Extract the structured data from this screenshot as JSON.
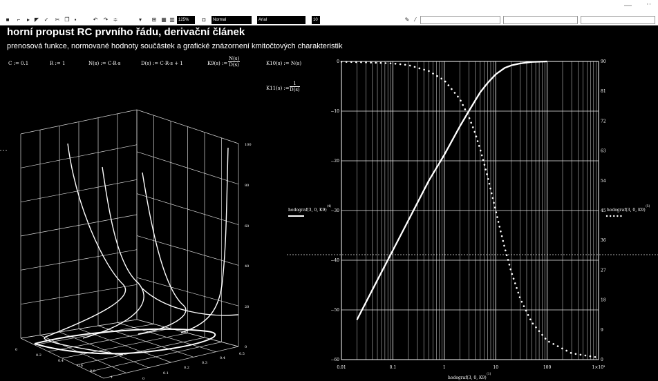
{
  "toolbar": {
    "zoom": "125%",
    "style": "Normal",
    "font": "Arial",
    "font_size": "10"
  },
  "document": {
    "title": "horní propust RC prvního řádu, derivační článek",
    "subtitle": "prenosová funkce, normované hodnoty součástek a grafické znázornení kmitočtových charakteristik",
    "definitions": [
      "C := 0.1",
      "R := 1",
      "N(s) := C·R·s",
      "D(s) := C·R·s + 1",
      "K10(s) := N(s)"
    ],
    "k9": {
      "lhs": "K9(s) :=",
      "num": "N(s)",
      "den": "D(s)"
    },
    "k11": {
      "lhs": "K11(s) :=",
      "num": "1",
      "den": "D(s)"
    }
  },
  "plot3d": {
    "z_ticks": [
      "100",
      "80",
      "60",
      "40",
      "20",
      "0"
    ],
    "x_ticks": [
      "0",
      "0.1",
      "0.2",
      "0.3",
      "0.4",
      "0.5"
    ],
    "y_ticks": [
      "0",
      "0.2",
      "0.4",
      "0.6",
      "0.8",
      "1"
    ]
  },
  "chart_data": {
    "type": "line",
    "x_scale": "log",
    "xlim": [
      0.01,
      1000
    ],
    "x_ticks": [
      "0.01",
      "0.1",
      "1",
      "10",
      "100",
      "1×10³"
    ],
    "ylim_left": [
      -60,
      0
    ],
    "y_ticks_left": [
      "0",
      "−10",
      "−20",
      "−30",
      "−40",
      "−50",
      "−60"
    ],
    "ylim_right": [
      0,
      90
    ],
    "y_ticks_right": [
      "90",
      "81",
      "72",
      "63",
      "54",
      "45",
      "36",
      "27",
      "18",
      "9",
      "0"
    ],
    "xlabel": "hodograf(3, 0, K9)",
    "xlabel_sup": "⟨1⟩",
    "ylabel_left": "hodograf(3, 0, K9)",
    "ylabel_left_sup": "⟨4⟩",
    "ylabel_right": "hodograf(3, 0, K9)",
    "ylabel_right_sup": "⟨5⟩",
    "series": [
      {
        "name": "",
        "axis": "left",
        "style": "solid",
        "x": [
          0.02,
          0.05,
          0.1,
          0.2,
          0.5,
          1,
          2,
          3,
          5,
          7,
          10,
          15,
          20,
          30,
          50,
          100
        ],
        "y": [
          -52,
          -44,
          -38,
          -32,
          -24,
          -18.8,
          -13.1,
          -10.0,
          -6.2,
          -4.3,
          -2.6,
          -1.3,
          -0.8,
          -0.4,
          -0.1,
          0
        ]
      },
      {
        "name": "",
        "axis": "right",
        "style": "dotted",
        "x": [
          0.01,
          0.03,
          0.1,
          0.2,
          0.5,
          1,
          2,
          3,
          4,
          5,
          6,
          7,
          8,
          10,
          12,
          15,
          20,
          30,
          50,
          100,
          300,
          1000
        ],
        "y": [
          89.9,
          89.7,
          89.4,
          88.9,
          87.1,
          84.3,
          78.7,
          73.3,
          68.3,
          63.4,
          59.0,
          55.0,
          51.3,
          45.0,
          39.8,
          33.7,
          26.6,
          18.4,
          11.3,
          5.7,
          1.9,
          0.6
        ]
      }
    ]
  }
}
